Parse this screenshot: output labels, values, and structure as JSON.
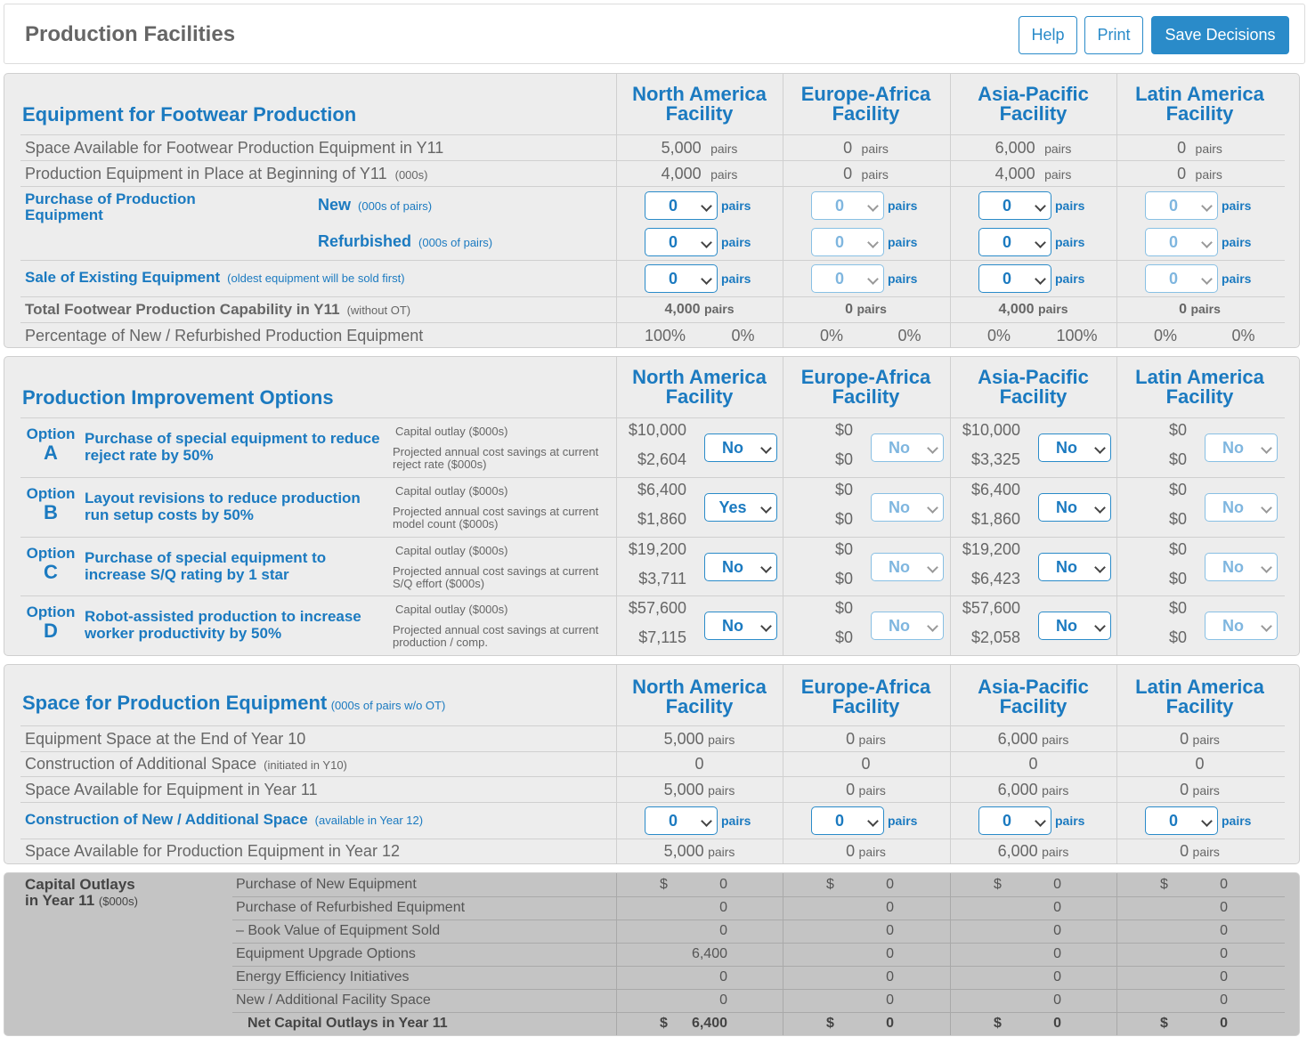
{
  "header": {
    "title": "Production Facilities",
    "help": "Help",
    "print": "Print",
    "save": "Save Decisions"
  },
  "facilities": [
    {
      "line1": "North America",
      "line2": "Facility"
    },
    {
      "line1": "Europe-Africa",
      "line2": "Facility"
    },
    {
      "line1": "Asia-Pacific",
      "line2": "Facility"
    },
    {
      "line1": "Latin America",
      "line2": "Facility"
    }
  ],
  "equipment": {
    "title": "Equipment for Footwear Production",
    "space_label": "Space Available for Footwear Production Equipment in Y11",
    "space": [
      "5,000",
      "0",
      "6,000",
      "0"
    ],
    "inplace_label": "Production Equipment in Place at Beginning of Y11",
    "inplace_note": "(000s)",
    "inplace": [
      "4,000",
      "0",
      "4,000",
      "0"
    ],
    "unit": "pairs",
    "purchase_label": "Purchase of Production Equipment",
    "new_label": "New",
    "new_note": "(000s of pairs)",
    "refurb_label": "Refurbished",
    "refurb_note": "(000s of pairs)",
    "new_sel": [
      "0",
      "0",
      "0",
      "0"
    ],
    "refurb_sel": [
      "0",
      "0",
      "0",
      "0"
    ],
    "sale_label": "Sale of Existing Equipment",
    "sale_note": "(oldest equipment will be sold first)",
    "sale_sel": [
      "0",
      "0",
      "0",
      "0"
    ],
    "total_label": "Total Footwear Production Capability in Y11",
    "total_note": "(without OT)",
    "total": [
      "4,000",
      "0",
      "4,000",
      "0"
    ],
    "pct_label": "Percentage of New / Refurbished Production Equipment",
    "pct": [
      [
        "100%",
        "0%"
      ],
      [
        "0%",
        "0%"
      ],
      [
        "0%",
        "100%"
      ],
      [
        "0%",
        "0%"
      ]
    ]
  },
  "improvement": {
    "title": "Production Improvement Options",
    "option_word": "Option",
    "capital_label": "Capital outlay  ($000s)",
    "options": [
      {
        "letter": "A",
        "text": "Purchase of special equipment to reduce reject rate by 50%",
        "savings_label": "Projected annual cost savings at current reject rate ($000s)",
        "capital": [
          "$10,000",
          "$0",
          "$10,000",
          "$0"
        ],
        "savings": [
          "$2,604",
          "$0",
          "$3,325",
          "$0"
        ],
        "choice": [
          "No",
          "No",
          "No",
          "No"
        ]
      },
      {
        "letter": "B",
        "text": "Layout revisions to reduce production run setup costs by 50%",
        "savings_label": "Projected annual cost savings at current model count ($000s)",
        "capital": [
          "$6,400",
          "$0",
          "$6,400",
          "$0"
        ],
        "savings": [
          "$1,860",
          "$0",
          "$1,860",
          "$0"
        ],
        "choice": [
          "Yes",
          "No",
          "No",
          "No"
        ]
      },
      {
        "letter": "C",
        "text": "Purchase of special equipment to increase S/Q rating by 1 star",
        "savings_label": "Projected annual cost savings at current S/Q effort ($000s)",
        "capital": [
          "$19,200",
          "$0",
          "$19,200",
          "$0"
        ],
        "savings": [
          "$3,711",
          "$0",
          "$6,423",
          "$0"
        ],
        "choice": [
          "No",
          "No",
          "No",
          "No"
        ]
      },
      {
        "letter": "D",
        "text": "Robot-assisted production to increase worker productivity by 50%",
        "savings_label": "Projected annual cost savings at current production / comp.",
        "capital": [
          "$57,600",
          "$0",
          "$57,600",
          "$0"
        ],
        "savings": [
          "$7,115",
          "$0",
          "$2,058",
          "$0"
        ],
        "choice": [
          "No",
          "No",
          "No",
          "No"
        ]
      }
    ]
  },
  "space": {
    "title": "Space for Production Equipment",
    "title_note": "(000s of pairs w/o OT)",
    "end_label": "Equipment Space at the End of Year 10",
    "end": [
      "5,000",
      "0",
      "6,000",
      "0"
    ],
    "constr_label": "Construction of Additional Space",
    "constr_note": "(initiated in Y10)",
    "constr": [
      "0",
      "0",
      "0",
      "0"
    ],
    "avail_label": "Space Available for Equipment in Year 11",
    "avail": [
      "5,000",
      "0",
      "6,000",
      "0"
    ],
    "new_label": "Construction of New / Additional Space",
    "new_note": "(available in Year 12)",
    "new_sel": [
      "0",
      "0",
      "0",
      "0"
    ],
    "y12_label": "Space Available for Production Equipment in Year 12",
    "y12": [
      "5,000",
      "0",
      "6,000",
      "0"
    ],
    "unit": "pairs"
  },
  "capital": {
    "title_line1": "Capital Outlays",
    "title_line2": "in Year 11",
    "title_note": "($000s)",
    "currency": "$",
    "rows": [
      {
        "label": "Purchase of New Equipment",
        "values": [
          "0",
          "0",
          "0",
          "0"
        ]
      },
      {
        "label": "Purchase of Refurbished Equipment",
        "values": [
          "0",
          "0",
          "0",
          "0"
        ]
      },
      {
        "label": "– Book Value of Equipment Sold",
        "values": [
          "0",
          "0",
          "0",
          "0"
        ]
      },
      {
        "label": "Equipment Upgrade Options",
        "values": [
          "6,400",
          "0",
          "0",
          "0"
        ]
      },
      {
        "label": "Energy Efficiency Initiatives",
        "values": [
          "0",
          "0",
          "0",
          "0"
        ]
      },
      {
        "label": "New / Additional Facility Space",
        "values": [
          "0",
          "0",
          "0",
          "0"
        ]
      }
    ],
    "net_label": "Net Capital Outlays in Year 11",
    "net": [
      "6,400",
      "0",
      "0",
      "0"
    ]
  }
}
